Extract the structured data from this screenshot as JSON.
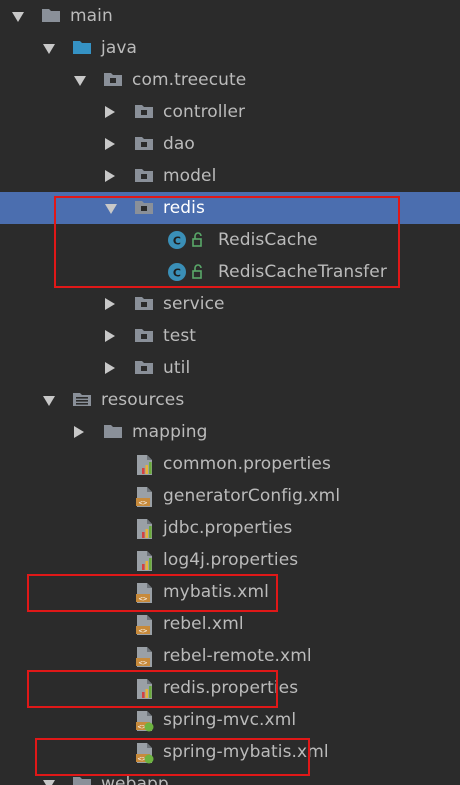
{
  "tree": {
    "items": [
      {
        "label": "main",
        "icon": "folder-icon",
        "arrow": "down",
        "level": 0
      },
      {
        "label": "java",
        "icon": "source-folder-icon",
        "arrow": "down",
        "level": 1
      },
      {
        "label": "com.treecute",
        "icon": "package-icon",
        "arrow": "down",
        "level": 2
      },
      {
        "label": "controller",
        "icon": "package-icon",
        "arrow": "right",
        "level": 3
      },
      {
        "label": "dao",
        "icon": "package-icon",
        "arrow": "right",
        "level": 3
      },
      {
        "label": "model",
        "icon": "package-icon",
        "arrow": "right",
        "level": 3
      },
      {
        "label": "redis",
        "icon": "package-icon",
        "arrow": "down",
        "level": 3,
        "selected": true
      },
      {
        "label": "RedisCache",
        "icon": "java-class-icon",
        "arrow": "",
        "level": 5
      },
      {
        "label": "RedisCacheTransfer",
        "icon": "java-class-icon",
        "arrow": "",
        "level": 5
      },
      {
        "label": "service",
        "icon": "package-icon",
        "arrow": "right",
        "level": 3
      },
      {
        "label": "test",
        "icon": "package-icon",
        "arrow": "right",
        "level": 3
      },
      {
        "label": "util",
        "icon": "package-icon",
        "arrow": "right",
        "level": 3
      },
      {
        "label": "resources",
        "icon": "resources-folder-icon",
        "arrow": "down",
        "level": 1
      },
      {
        "label": "mapping",
        "icon": "folder-icon",
        "arrow": "right",
        "level": 2
      },
      {
        "label": "common.properties",
        "icon": "properties-file-icon",
        "arrow": "",
        "level": 3
      },
      {
        "label": "generatorConfig.xml",
        "icon": "xml-file-icon",
        "arrow": "",
        "level": 3
      },
      {
        "label": "jdbc.properties",
        "icon": "properties-file-icon",
        "arrow": "",
        "level": 3
      },
      {
        "label": "log4j.properties",
        "icon": "properties-file-icon",
        "arrow": "",
        "level": 3
      },
      {
        "label": "mybatis.xml",
        "icon": "xml-file-icon",
        "arrow": "",
        "level": 3
      },
      {
        "label": "rebel.xml",
        "icon": "xml-file-icon",
        "arrow": "",
        "level": 3
      },
      {
        "label": "rebel-remote.xml",
        "icon": "xml-file-icon",
        "arrow": "",
        "level": 3
      },
      {
        "label": "redis.properties",
        "icon": "properties-file-icon",
        "arrow": "",
        "level": 3
      },
      {
        "label": "spring-mvc.xml",
        "icon": "spring-xml-file-icon",
        "arrow": "",
        "level": 3
      },
      {
        "label": "spring-mybatis.xml",
        "icon": "spring-xml-file-icon",
        "arrow": "",
        "level": 3
      },
      {
        "label": "webapp",
        "icon": "folder-icon",
        "arrow": "down",
        "level": 1
      }
    ]
  },
  "colors": {
    "background": "#2b2b2b",
    "selection": "#4b6eaf",
    "text": "#bbbbbb",
    "highlight_box": "#e01818",
    "folder": "#8a9099",
    "source_folder": "#3592c4",
    "java_class": "#3a8fb7"
  }
}
